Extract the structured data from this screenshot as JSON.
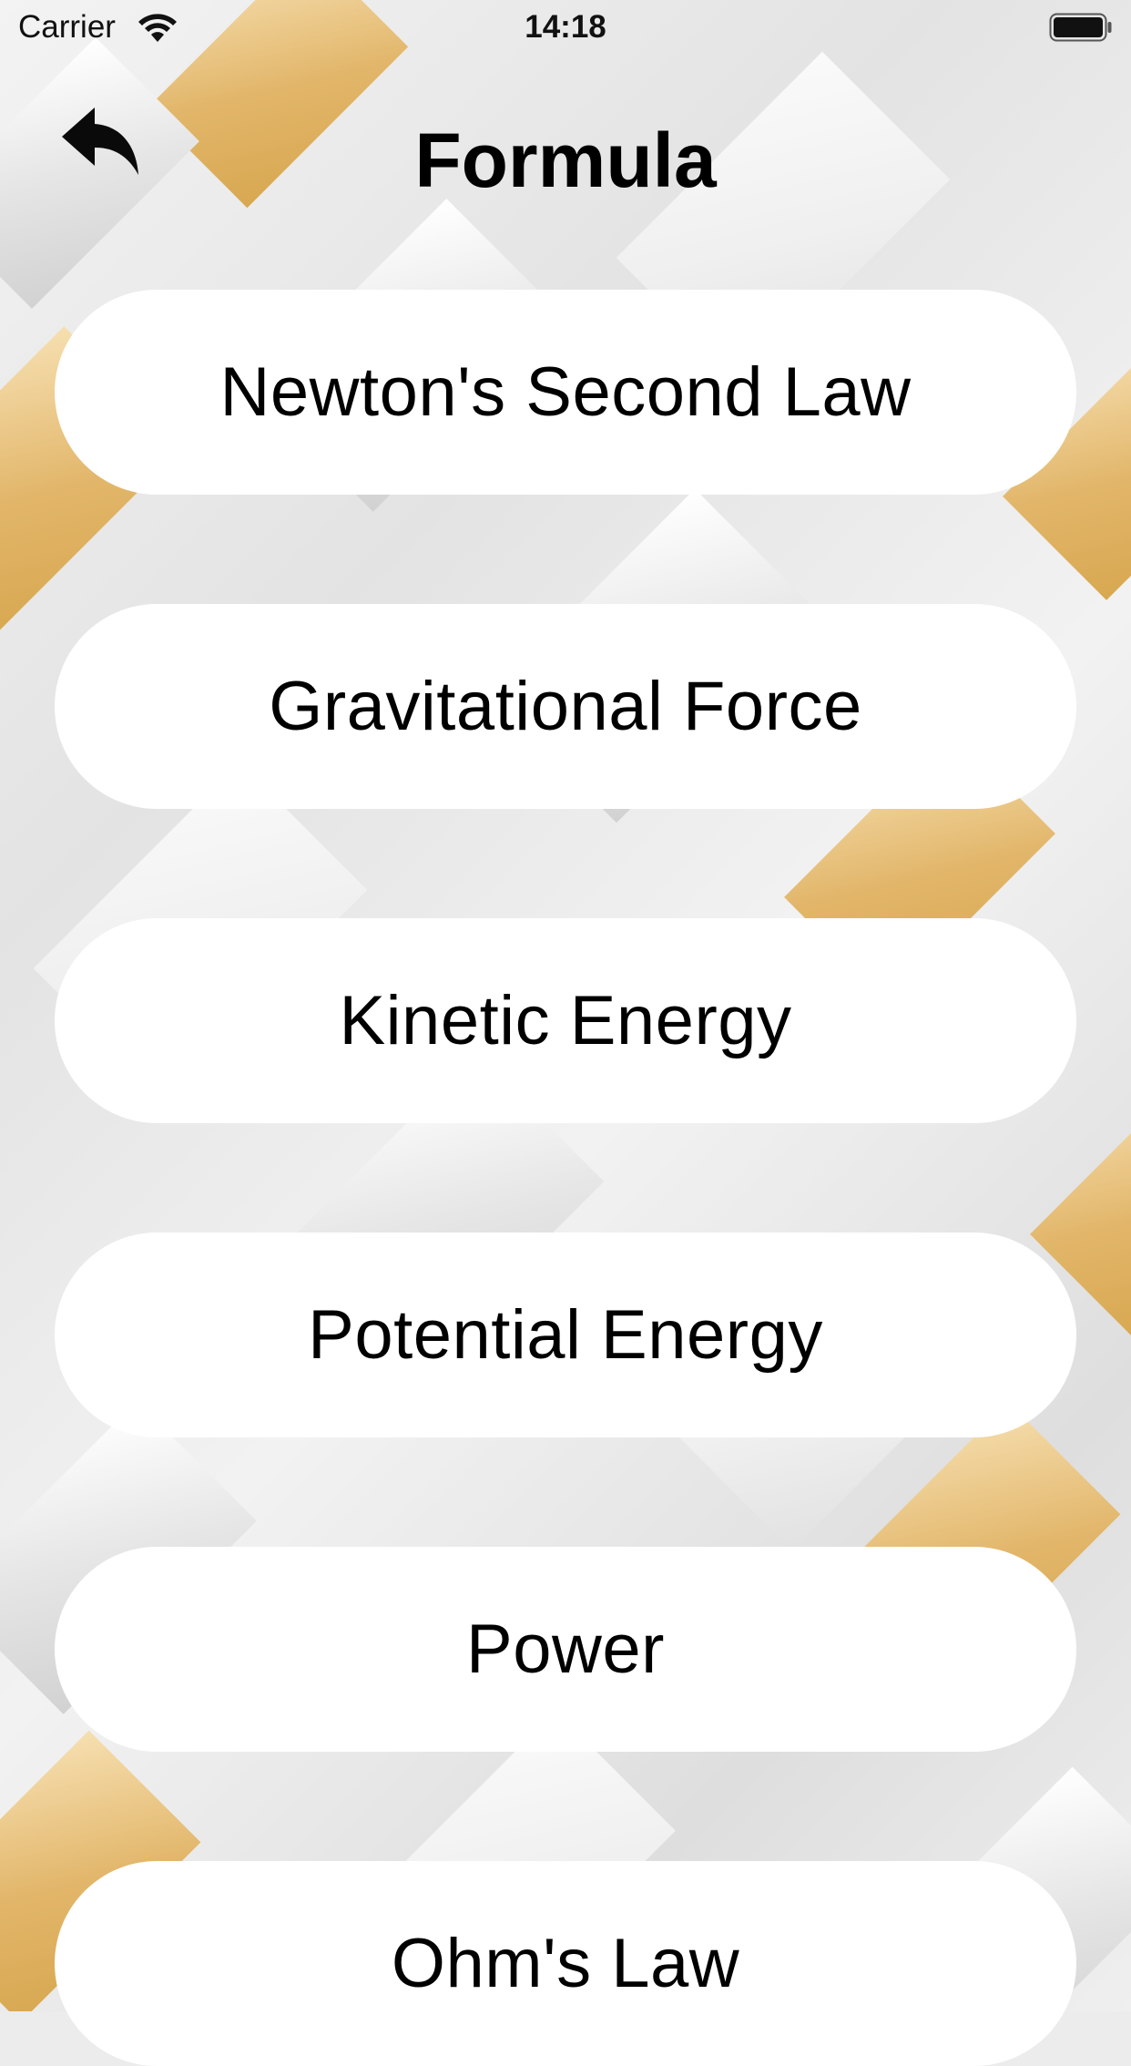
{
  "status_bar": {
    "carrier": "Carrier",
    "time": "14:18",
    "icons": [
      "wifi-icon",
      "battery-icon"
    ]
  },
  "nav": {
    "title": "Formula",
    "back_icon": "back-arrow-icon"
  },
  "formulas": [
    {
      "label": "Newton's Second Law"
    },
    {
      "label": "Gravitational Force"
    },
    {
      "label": "Kinetic Energy"
    },
    {
      "label": "Potential Energy"
    },
    {
      "label": "Power"
    },
    {
      "label": "Ohm's Law"
    }
  ],
  "colors": {
    "button_background": "#ffffff",
    "text": "#000000",
    "gold_accent": "#e2b66a",
    "background": "#ececec"
  }
}
